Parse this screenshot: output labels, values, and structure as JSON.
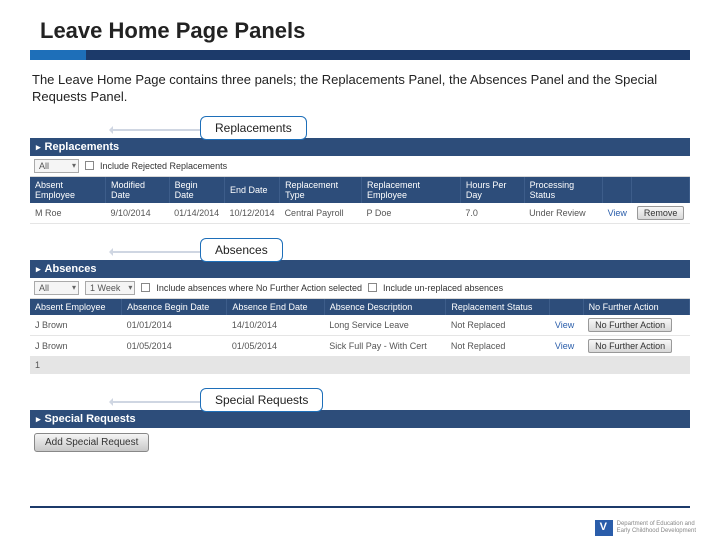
{
  "title": "Leave Home Page Panels",
  "intro": "The Leave Home Page contains three panels; the Replacements Panel, the Absences Panel and the Special Requests Panel.",
  "callouts": {
    "replacements": "Replacements",
    "absences": "Absences",
    "special": "Special Requests"
  },
  "replacements": {
    "header": "Replacements",
    "filter_all": "All",
    "checkbox_label": "Include Rejected Replacements",
    "columns": [
      "Absent Employee",
      "Modified Date",
      "Begin Date",
      "End Date",
      "Replacement Type",
      "Replacement Employee",
      "Hours Per Day",
      "Processing Status",
      "",
      ""
    ],
    "row": {
      "emp": "M Roe",
      "mod": "9/10/2014",
      "begin": "01/14/2014",
      "end": "10/12/2014",
      "type": "Central Payroll",
      "remp": "P Doe",
      "hours": "7.0",
      "status": "Under Review",
      "view": "View",
      "btn": "Remove"
    }
  },
  "absences": {
    "header": "Absences",
    "filter_all": "All",
    "filter_period": "1 Week",
    "check1": "Include absences where No Further Action selected",
    "check2": "Include un-replaced absences",
    "columns": [
      "Absent Employee",
      "Absence Begin Date",
      "Absence End Date",
      "Absence Description",
      "Replacement Status",
      "",
      "No Further Action"
    ],
    "rows": [
      {
        "emp": "J Brown",
        "begin": "01/01/2014",
        "end": "14/10/2014",
        "desc": "Long Service Leave",
        "status": "Not Replaced",
        "view": "View",
        "btn": "No Further Action"
      },
      {
        "emp": "J Brown",
        "begin": "01/05/2014",
        "end": "01/05/2014",
        "desc": "Sick Full Pay - With Cert",
        "status": "Not Replaced",
        "view": "View",
        "btn": "No Further Action"
      }
    ],
    "total_label": "1"
  },
  "special": {
    "header": "Special Requests",
    "add_btn": "Add Special Request"
  },
  "footer": {
    "brand": "Victoria",
    "dept1": "Department of Education and",
    "dept2": "Early Childhood Development"
  }
}
